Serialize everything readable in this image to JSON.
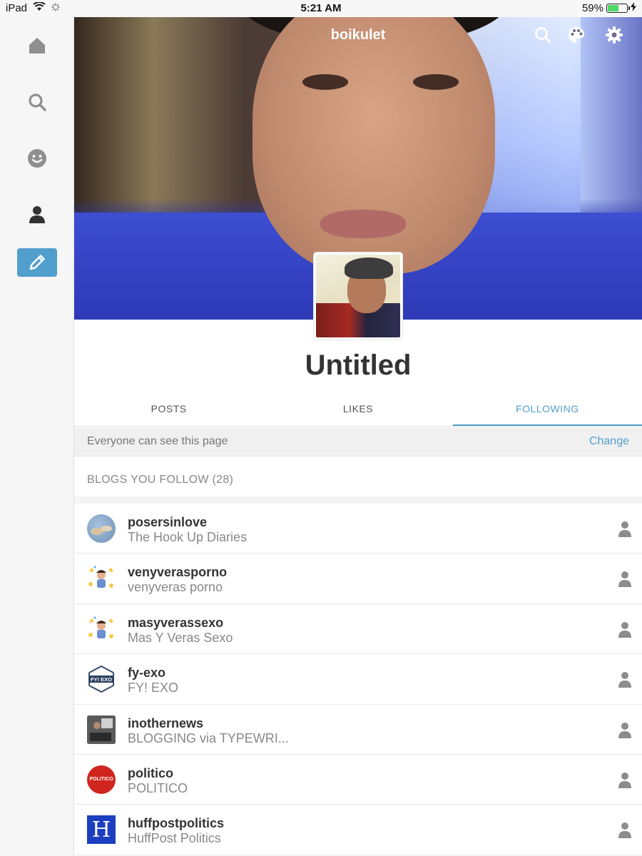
{
  "status_bar": {
    "device": "iPad",
    "time": "5:21 AM",
    "battery_percent": "59%",
    "battery_level": 0.59
  },
  "sidebar": {
    "items": [
      {
        "icon": "home-icon"
      },
      {
        "icon": "search-icon"
      },
      {
        "icon": "smiley-icon"
      },
      {
        "icon": "account-icon"
      },
      {
        "icon": "pencil-icon"
      }
    ],
    "accent": "#529ecc"
  },
  "header": {
    "blog_name": "boikulet",
    "icons": [
      "search-icon",
      "palette-icon",
      "gear-icon"
    ]
  },
  "profile": {
    "title": "Untitled"
  },
  "tabs": [
    {
      "label": "POSTS",
      "active": false
    },
    {
      "label": "LIKES",
      "active": false
    },
    {
      "label": "FOLLOWING",
      "active": true
    }
  ],
  "visibility": {
    "text": "Everyone can see this page",
    "action": "Change"
  },
  "following": {
    "heading": "BLOGS YOU FOLLOW (28)",
    "blogs": [
      {
        "name": "posersinlove",
        "title": "The Hook Up Diaries"
      },
      {
        "name": "venyverasporno",
        "title": "venyveras porno"
      },
      {
        "name": "masyverassexo",
        "title": "Mas Y Veras Sexo"
      },
      {
        "name": "fy-exo",
        "title": "FY! EXO",
        "badge": "FY! EXO"
      },
      {
        "name": "inothernews",
        "title": "BLOGGING via TYPEWRI..."
      },
      {
        "name": "politico",
        "title": "POLITICO",
        "badge": "POLITICO"
      },
      {
        "name": "huffpostpolitics",
        "title": "HuffPost Politics",
        "badge": "H"
      }
    ]
  }
}
